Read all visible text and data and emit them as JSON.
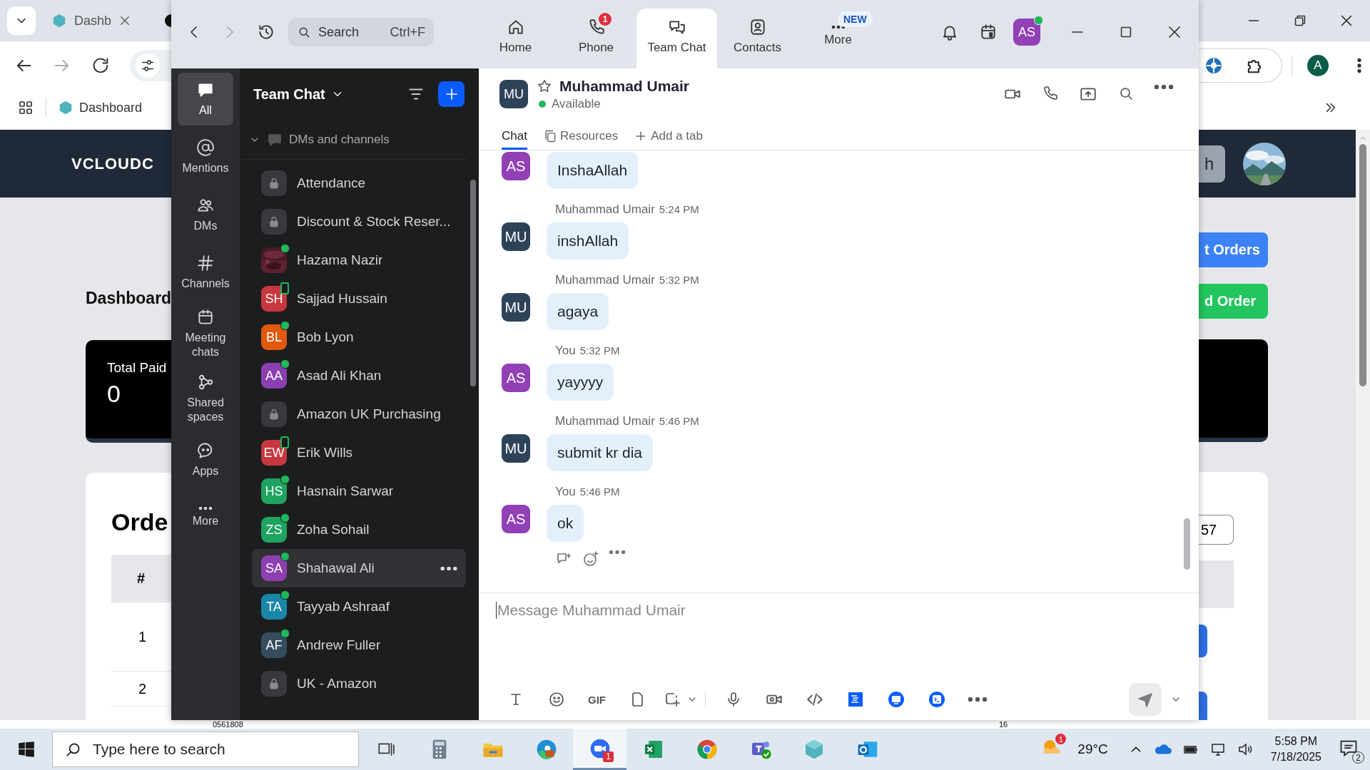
{
  "browser": {
    "tabs": [
      {
        "title": "Dashb",
        "selected": false
      }
    ],
    "bookmark": "Dashboard",
    "logo": "VCLOUDC",
    "profile_initial": "A",
    "page": {
      "heading": "Dashboard",
      "header_button": "h",
      "action_buttons": [
        {
          "label": "t Orders",
          "kind": "primary"
        },
        {
          "label": "d Order",
          "kind": "success"
        }
      ],
      "stat_card": {
        "label": "Total Paid",
        "value": "0"
      },
      "orders": {
        "title": "Orde",
        "search_value": "57",
        "header_cell": "#",
        "rows": [
          {
            "number": "1"
          },
          {
            "number": "2"
          }
        ]
      },
      "bottom_texts": [
        "0561808",
        "16"
      ]
    }
  },
  "zoom": {
    "search": {
      "placeholder": "Search",
      "shortcut": "Ctrl+F"
    },
    "nav_tabs": [
      {
        "label": "Home",
        "selected": false
      },
      {
        "label": "Phone",
        "selected": false,
        "badge": {
          "text": "1",
          "kind": "count"
        }
      },
      {
        "label": "Team Chat",
        "selected": true
      },
      {
        "label": "Contacts",
        "selected": false
      },
      {
        "label": "More",
        "selected": false,
        "badge": {
          "text": "NEW",
          "kind": "label"
        }
      }
    ],
    "profile": {
      "initials": "AS",
      "color": "#9140b6",
      "online": true
    },
    "rail": [
      {
        "label": "All",
        "selected": true
      },
      {
        "label": "Mentions",
        "selected": false
      },
      {
        "label": "DMs",
        "selected": false
      },
      {
        "label": "Channels",
        "selected": false
      },
      {
        "label": "Meeting chats",
        "selected": false
      },
      {
        "label": "Shared spaces",
        "selected": false
      },
      {
        "label": "Apps",
        "selected": false
      },
      {
        "label": "More",
        "selected": false
      }
    ],
    "list": {
      "title": "Team Chat",
      "section": {
        "label": "DMs and channels",
        "expanded": true
      },
      "items": [
        {
          "kind": "channel",
          "name": "Attendance",
          "selected": false
        },
        {
          "kind": "channel",
          "name": "Discount & Stock Reser...",
          "selected": false
        },
        {
          "name": "Hazama Nazir",
          "online": true,
          "mobile": false,
          "selected": false
        },
        {
          "kind": "person",
          "initials": "SH",
          "color": "#c8373f",
          "name": "Sajjad Hussain",
          "online": false,
          "mobile": true,
          "selected": false
        },
        {
          "kind": "person",
          "initials": "BL",
          "color": "#e0590c",
          "name": "Bob Lyon",
          "online": true,
          "mobile": false,
          "selected": false
        },
        {
          "kind": "person",
          "initials": "AA",
          "color": "#8a3fb0",
          "name": "Asad Ali Khan",
          "online": true,
          "mobile": false,
          "selected": false
        },
        {
          "kind": "channel",
          "name": "Amazon UK Purchasing",
          "selected": false
        },
        {
          "kind": "person",
          "initials": "EW",
          "color": "#c8373f",
          "name": "Erik Wills",
          "online": false,
          "mobile": true,
          "selected": false
        },
        {
          "kind": "person",
          "initials": "HS",
          "color": "#1ea360",
          "name": "Hasnain Sarwar",
          "online": true,
          "mobile": false,
          "selected": false
        },
        {
          "kind": "person",
          "initials": "ZS",
          "color": "#1ea360",
          "name": "Zoha Sohail",
          "online": true,
          "mobile": false,
          "selected": false
        },
        {
          "kind": "person",
          "initials": "SA",
          "color": "#8e3fb0",
          "name": "Shahawal Ali",
          "online": true,
          "mobile": false,
          "selected": true
        },
        {
          "kind": "person",
          "initials": "TA",
          "color": "#1a87a8",
          "name": "Tayyab Ashraaf",
          "online": true,
          "mobile": false,
          "selected": false
        },
        {
          "kind": "person",
          "initials": "AF",
          "color": "#354d5d",
          "name": "Andrew Fuller",
          "online": true,
          "mobile": false,
          "selected": false
        },
        {
          "kind": "channel",
          "name": "UK - Amazon",
          "selected": false
        }
      ]
    },
    "chat": {
      "contact": {
        "initials": "MU",
        "color": "#2e435a",
        "name": "Muhammad Umair",
        "status": "Available"
      },
      "tabs": [
        {
          "label": "Chat",
          "selected": true
        },
        {
          "label": "Resources",
          "selected": false
        }
      ],
      "add_tab": "Add a tab",
      "messages": [
        {
          "initials": "AS",
          "color": "#9140b6",
          "text": "InshaAllah"
        },
        {
          "author": "Muhammad Umair",
          "time": "5:24 PM",
          "initials": "MU",
          "color": "#2e435a",
          "text": "inshAllah"
        },
        {
          "author": "Muhammad Umair",
          "time": "5:32 PM",
          "initials": "MU",
          "color": "#2e435a",
          "text": "agaya"
        },
        {
          "author": "You",
          "time": "5:32 PM",
          "initials": "AS",
          "color": "#9140b6",
          "text": "yayyyy"
        },
        {
          "author": "Muhammad Umair",
          "time": "5:46 PM",
          "initials": "MU",
          "color": "#2e435a",
          "text": "submit kr dia"
        },
        {
          "author": "You",
          "time": "5:46 PM",
          "initials": "AS",
          "color": "#9140b6",
          "text": "ok"
        }
      ],
      "composer": {
        "placeholder": "Message Muhammad Umair",
        "gif_label": "GIF"
      }
    }
  },
  "taskbar": {
    "search": {
      "placeholder": "Type here to search"
    },
    "apps": [
      {
        "kind": "calculator",
        "selected": false
      },
      {
        "kind": "files",
        "selected": false
      },
      {
        "kind": "edge",
        "selected": false
      },
      {
        "kind": "zoom",
        "selected": true,
        "badge": "1"
      },
      {
        "kind": "excel",
        "selected": false
      },
      {
        "kind": "chrome",
        "selected": false
      },
      {
        "kind": "teams",
        "selected": false
      },
      {
        "kind": "diamond",
        "selected": false
      },
      {
        "kind": "outlook",
        "selected": false
      }
    ],
    "weather": {
      "badge": "1",
      "temperature": "29°C"
    },
    "clock": {
      "time": "5:58 PM",
      "date": "7/18/2025"
    },
    "notifications": {
      "count": "2"
    }
  }
}
